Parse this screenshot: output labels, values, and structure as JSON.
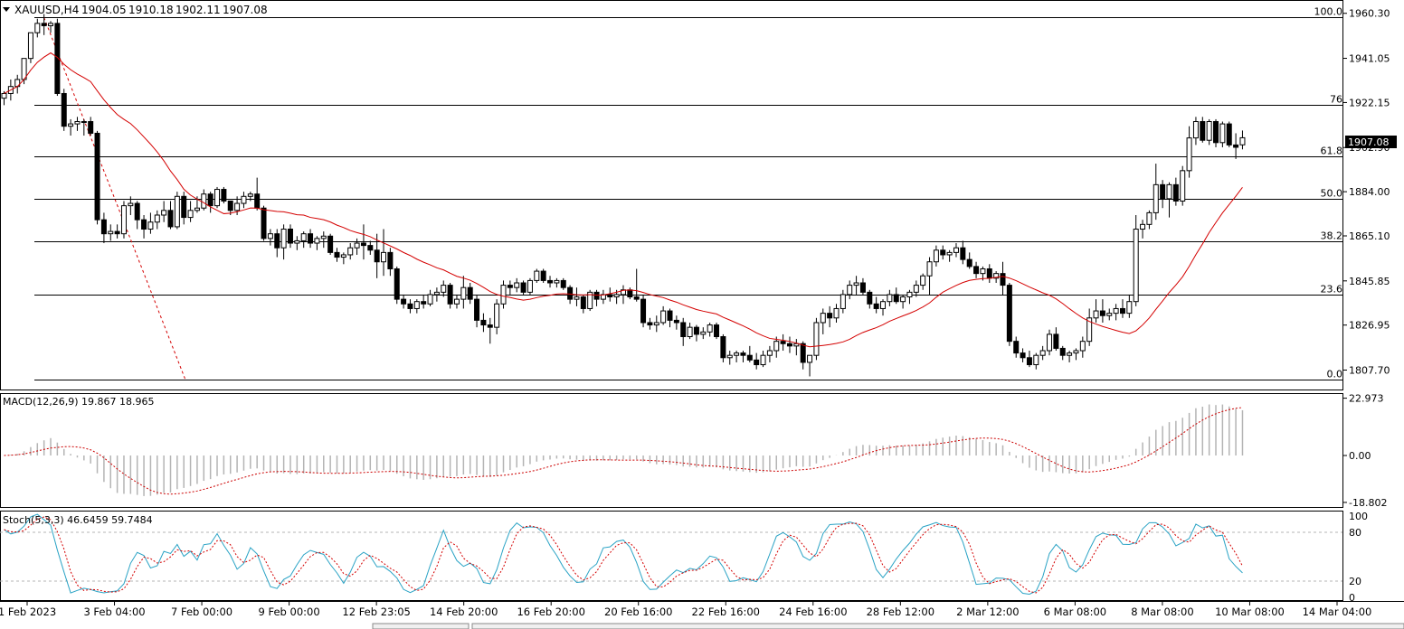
{
  "chart_data": {
    "type": "candlestick",
    "header": {
      "symbol": "XAUUSD,H4",
      "open": "1904.05",
      "high": "1910.18",
      "low": "1902.11",
      "close": "1907.08"
    },
    "current_price_label": "1907.08",
    "price_axis": {
      "ylim": [
        1799.0,
        1966.0
      ],
      "ticks": [
        "1960.30",
        "1941.05",
        "1922.15",
        "1902.90",
        "1884.00",
        "1865.10",
        "1845.85",
        "1826.95",
        "1807.70"
      ]
    },
    "fibonacci": {
      "swing_high": 1958.5,
      "swing_low": 1803.5,
      "levels": [
        {
          "label": "100.0",
          "ratio": 1.0
        },
        {
          "label": "76",
          "ratio": 0.76
        },
        {
          "label": "61.8",
          "ratio": 0.618
        },
        {
          "label": "50.0",
          "ratio": 0.5
        },
        {
          "label": "38.2",
          "ratio": 0.382
        },
        {
          "label": "23.6",
          "ratio": 0.236
        },
        {
          "label": "0.0",
          "ratio": 0.0
        }
      ]
    },
    "candles": [
      [
        1924.0,
        1927.0,
        1921.0,
        1926.0
      ],
      [
        1926.0,
        1932.0,
        1923.0,
        1929.0
      ],
      [
        1929.0,
        1934.0,
        1926.0,
        1932.0
      ],
      [
        1932.0,
        1940.0,
        1930.0,
        1941.0
      ],
      [
        1941.0,
        1950.0,
        1939.0,
        1952.0
      ],
      [
        1952.0,
        1958.0,
        1950.0,
        1956.0
      ],
      [
        1956.0,
        1960.0,
        1951.0,
        1955.0
      ],
      [
        1955.0,
        1957.0,
        1952.0,
        1956.0
      ],
      [
        1956.0,
        1958.0,
        1925.0,
        1926.0
      ],
      [
        1926.0,
        1928.0,
        1910.0,
        1912.0
      ],
      [
        1912.0,
        1915.0,
        1908.0,
        1913.0
      ],
      [
        1913.0,
        1916.0,
        1910.0,
        1914.0
      ],
      [
        1914.0,
        1915.0,
        1908.0,
        1914.0
      ],
      [
        1914.0,
        1916.0,
        1908.0,
        1909.0
      ],
      [
        1909.0,
        1910.0,
        1870.0,
        1872.0
      ],
      [
        1872.0,
        1875.0,
        1862.0,
        1866.0
      ],
      [
        1866.0,
        1870.0,
        1863.0,
        1867.0
      ],
      [
        1867.0,
        1870.0,
        1864.0,
        1866.0
      ],
      [
        1866.0,
        1880.0,
        1864.0,
        1878.0
      ],
      [
        1878.0,
        1882.0,
        1874.0,
        1879.0
      ],
      [
        1879.0,
        1880.0,
        1868.0,
        1872.0
      ],
      [
        1872.0,
        1874.0,
        1864.0,
        1868.0
      ],
      [
        1868.0,
        1875.0,
        1866.0,
        1871.0
      ],
      [
        1871.0,
        1876.0,
        1868.0,
        1874.0
      ],
      [
        1874.0,
        1880.0,
        1871.0,
        1876.0
      ],
      [
        1876.0,
        1880.0,
        1868.0,
        1869.0
      ],
      [
        1869.0,
        1884.0,
        1868.0,
        1882.0
      ],
      [
        1882.0,
        1884.0,
        1870.0,
        1873.0
      ],
      [
        1873.0,
        1880.0,
        1871.0,
        1876.0
      ],
      [
        1876.0,
        1882.0,
        1875.0,
        1877.0
      ],
      [
        1877.0,
        1885.0,
        1876.0,
        1883.0
      ],
      [
        1883.0,
        1884.0,
        1875.0,
        1878.0
      ],
      [
        1878.0,
        1886.0,
        1877.0,
        1885.0
      ],
      [
        1885.0,
        1886.0,
        1879.0,
        1880.0
      ],
      [
        1880.0,
        1880.0,
        1874.0,
        1876.0
      ],
      [
        1876.0,
        1882.0,
        1874.0,
        1879.0
      ],
      [
        1879.0,
        1884.0,
        1877.0,
        1882.0
      ],
      [
        1882.0,
        1884.0,
        1880.0,
        1883.0
      ],
      [
        1883.0,
        1890.0,
        1876.0,
        1877.0
      ],
      [
        1877.0,
        1878.0,
        1863.0,
        1864.0
      ],
      [
        1864.0,
        1868.0,
        1861.0,
        1866.0
      ],
      [
        1866.0,
        1868.0,
        1856.0,
        1860.0
      ],
      [
        1860.0,
        1870.0,
        1855.0,
        1868.0
      ],
      [
        1868.0,
        1870.0,
        1860.0,
        1862.0
      ],
      [
        1862.0,
        1865.0,
        1859.0,
        1863.0
      ],
      [
        1863.0,
        1867.0,
        1860.0,
        1866.0
      ],
      [
        1866.0,
        1868.0,
        1860.0,
        1862.0
      ],
      [
        1862.0,
        1865.0,
        1859.0,
        1864.0
      ],
      [
        1864.0,
        1867.0,
        1860.0,
        1865.0
      ],
      [
        1865.0,
        1866.0,
        1857.0,
        1858.0
      ],
      [
        1858.0,
        1860.0,
        1854.0,
        1856.0
      ],
      [
        1856.0,
        1858.0,
        1853.0,
        1857.0
      ],
      [
        1857.0,
        1862.0,
        1855.0,
        1860.0
      ],
      [
        1860.0,
        1864.0,
        1857.0,
        1862.0
      ],
      [
        1862.0,
        1870.0,
        1855.0,
        1861.0
      ],
      [
        1861.0,
        1863.0,
        1857.0,
        1859.0
      ],
      [
        1859.0,
        1866.0,
        1847.0,
        1854.0
      ],
      [
        1854.0,
        1868.0,
        1848.0,
        1858.0
      ],
      [
        1858.0,
        1860.0,
        1848.0,
        1851.0
      ],
      [
        1851.0,
        1852.0,
        1836.0,
        1838.0
      ],
      [
        1838.0,
        1840.0,
        1834.0,
        1836.0
      ],
      [
        1836.0,
        1838.0,
        1832.0,
        1834.0
      ],
      [
        1834.0,
        1838.0,
        1832.0,
        1837.0
      ],
      [
        1837.0,
        1840.0,
        1834.0,
        1836.0
      ],
      [
        1836.0,
        1842.0,
        1835.0,
        1840.0
      ],
      [
        1840.0,
        1843.0,
        1837.0,
        1841.0
      ],
      [
        1841.0,
        1846.0,
        1839.0,
        1844.0
      ],
      [
        1844.0,
        1845.0,
        1834.0,
        1836.0
      ],
      [
        1836.0,
        1840.0,
        1834.0,
        1838.0
      ],
      [
        1838.0,
        1848.0,
        1834.0,
        1843.0
      ],
      [
        1843.0,
        1845.0,
        1836.0,
        1838.0
      ],
      [
        1838.0,
        1840.0,
        1826.0,
        1829.0
      ],
      [
        1829.0,
        1832.0,
        1824.0,
        1827.0
      ],
      [
        1827.0,
        1830.0,
        1819.0,
        1826.0
      ],
      [
        1826.0,
        1838.0,
        1823.0,
        1836.0
      ],
      [
        1836.0,
        1846.0,
        1834.0,
        1844.0
      ],
      [
        1844.0,
        1846.0,
        1840.0,
        1843.0
      ],
      [
        1843.0,
        1847.0,
        1841.0,
        1845.0
      ],
      [
        1845.0,
        1846.0,
        1840.0,
        1841.0
      ],
      [
        1841.0,
        1847.0,
        1840.0,
        1846.0
      ],
      [
        1846.0,
        1851.0,
        1845.0,
        1850.0
      ],
      [
        1850.0,
        1851.0,
        1845.0,
        1846.0
      ],
      [
        1846.0,
        1848.0,
        1843.0,
        1845.0
      ],
      [
        1845.0,
        1847.0,
        1843.0,
        1846.0
      ],
      [
        1846.0,
        1847.0,
        1842.0,
        1843.0
      ],
      [
        1843.0,
        1844.0,
        1836.0,
        1838.0
      ],
      [
        1838.0,
        1843.0,
        1835.0,
        1839.0
      ],
      [
        1839.0,
        1840.0,
        1832.0,
        1834.0
      ],
      [
        1834.0,
        1842.0,
        1833.0,
        1841.0
      ],
      [
        1841.0,
        1842.0,
        1835.0,
        1838.0
      ],
      [
        1838.0,
        1842.0,
        1836.0,
        1840.0
      ],
      [
        1840.0,
        1843.0,
        1837.0,
        1839.0
      ],
      [
        1839.0,
        1842.0,
        1836.0,
        1840.0
      ],
      [
        1840.0,
        1844.0,
        1836.0,
        1842.0
      ],
      [
        1842.0,
        1843.0,
        1838.0,
        1839.0
      ],
      [
        1839.0,
        1851.0,
        1837.0,
        1838.0
      ],
      [
        1838.0,
        1840.0,
        1826.0,
        1828.0
      ],
      [
        1828.0,
        1830.0,
        1825.0,
        1827.0
      ],
      [
        1827.0,
        1831.0,
        1824.0,
        1828.0
      ],
      [
        1828.0,
        1835.0,
        1827.0,
        1833.0
      ],
      [
        1833.0,
        1834.0,
        1826.0,
        1829.0
      ],
      [
        1829.0,
        1831.0,
        1825.0,
        1828.0
      ],
      [
        1828.0,
        1830.0,
        1818.0,
        1822.0
      ],
      [
        1822.0,
        1828.0,
        1821.0,
        1826.0
      ],
      [
        1826.0,
        1827.0,
        1820.0,
        1823.0
      ],
      [
        1823.0,
        1826.0,
        1821.0,
        1824.0
      ],
      [
        1824.0,
        1828.0,
        1822.0,
        1827.0
      ],
      [
        1827.0,
        1828.0,
        1821.0,
        1822.0
      ],
      [
        1822.0,
        1823.0,
        1811.0,
        1813.0
      ],
      [
        1813.0,
        1816.0,
        1810.0,
        1814.0
      ],
      [
        1814.0,
        1816.0,
        1811.0,
        1815.0
      ],
      [
        1815.0,
        1816.0,
        1811.0,
        1814.0
      ],
      [
        1814.0,
        1818.0,
        1811.0,
        1812.0
      ],
      [
        1812.0,
        1815.0,
        1808.0,
        1810.0
      ],
      [
        1810.0,
        1816.0,
        1809.0,
        1814.0
      ],
      [
        1814.0,
        1818.0,
        1811.0,
        1816.0
      ],
      [
        1816.0,
        1822.0,
        1813.0,
        1820.0
      ],
      [
        1820.0,
        1823.0,
        1816.0,
        1819.0
      ],
      [
        1819.0,
        1822.0,
        1815.0,
        1818.0
      ],
      [
        1818.0,
        1821.0,
        1814.0,
        1819.0
      ],
      [
        1819.0,
        1820.0,
        1808.0,
        1811.0
      ],
      [
        1811.0,
        1813.0,
        1805.0,
        1814.0
      ],
      [
        1814.0,
        1830.0,
        1812.0,
        1828.0
      ],
      [
        1828.0,
        1834.0,
        1823.0,
        1832.0
      ],
      [
        1832.0,
        1835.0,
        1826.0,
        1830.0
      ],
      [
        1830.0,
        1836.0,
        1828.0,
        1834.0
      ],
      [
        1834.0,
        1842.0,
        1832.0,
        1840.0
      ],
      [
        1840.0,
        1846.0,
        1838.0,
        1844.0
      ],
      [
        1844.0,
        1848.0,
        1840.0,
        1845.0
      ],
      [
        1845.0,
        1847.0,
        1840.0,
        1841.0
      ],
      [
        1841.0,
        1842.0,
        1834.0,
        1836.0
      ],
      [
        1836.0,
        1839.0,
        1832.0,
        1834.0
      ],
      [
        1834.0,
        1838.0,
        1831.0,
        1837.0
      ],
      [
        1837.0,
        1842.0,
        1835.0,
        1840.0
      ],
      [
        1840.0,
        1843.0,
        1836.0,
        1837.0
      ],
      [
        1837.0,
        1840.0,
        1834.0,
        1839.0
      ],
      [
        1839.0,
        1842.0,
        1836.0,
        1841.0
      ],
      [
        1841.0,
        1846.0,
        1839.0,
        1844.0
      ],
      [
        1844.0,
        1849.0,
        1842.0,
        1848.0
      ],
      [
        1848.0,
        1856.0,
        1840.0,
        1854.0
      ],
      [
        1854.0,
        1861.0,
        1852.0,
        1859.0
      ],
      [
        1859.0,
        1861.0,
        1855.0,
        1857.0
      ],
      [
        1857.0,
        1859.0,
        1854.0,
        1858.0
      ],
      [
        1858.0,
        1862.0,
        1856.0,
        1860.0
      ],
      [
        1860.0,
        1863.0,
        1853.0,
        1855.0
      ],
      [
        1855.0,
        1858.0,
        1851.0,
        1852.0
      ],
      [
        1852.0,
        1854.0,
        1847.0,
        1849.0
      ],
      [
        1849.0,
        1852.0,
        1846.0,
        1851.0
      ],
      [
        1851.0,
        1853.0,
        1845.0,
        1847.0
      ],
      [
        1847.0,
        1850.0,
        1845.0,
        1849.0
      ],
      [
        1849.0,
        1854.0,
        1840.0,
        1844.0
      ],
      [
        1844.0,
        1845.0,
        1818.0,
        1820.0
      ],
      [
        1820.0,
        1822.0,
        1813.0,
        1815.0
      ],
      [
        1815.0,
        1817.0,
        1811.0,
        1813.0
      ],
      [
        1813.0,
        1816.0,
        1809.0,
        1810.0
      ],
      [
        1810.0,
        1815.0,
        1808.0,
        1814.0
      ],
      [
        1814.0,
        1818.0,
        1812.0,
        1816.0
      ],
      [
        1816.0,
        1825.0,
        1814.0,
        1823.0
      ],
      [
        1823.0,
        1826.0,
        1816.0,
        1817.0
      ],
      [
        1817.0,
        1818.0,
        1812.0,
        1814.0
      ],
      [
        1814.0,
        1816.0,
        1811.0,
        1815.0
      ],
      [
        1815.0,
        1817.0,
        1812.0,
        1816.0
      ],
      [
        1816.0,
        1822.0,
        1813.0,
        1820.0
      ],
      [
        1820.0,
        1834.0,
        1818.0,
        1830.0
      ],
      [
        1830.0,
        1838.0,
        1828.0,
        1833.0
      ],
      [
        1833.0,
        1838.0,
        1828.0,
        1831.0
      ],
      [
        1831.0,
        1834.0,
        1829.0,
        1832.0
      ],
      [
        1832.0,
        1836.0,
        1829.0,
        1834.0
      ],
      [
        1834.0,
        1838.0,
        1830.0,
        1832.0
      ],
      [
        1832.0,
        1840.0,
        1830.0,
        1837.0
      ],
      [
        1837.0,
        1874.0,
        1835.0,
        1868.0
      ],
      [
        1868.0,
        1872.0,
        1864.0,
        1870.0
      ],
      [
        1870.0,
        1876.0,
        1868.0,
        1875.0
      ],
      [
        1875.0,
        1896.0,
        1872.0,
        1887.0
      ],
      [
        1887.0,
        1889.0,
        1877.0,
        1881.0
      ],
      [
        1881.0,
        1888.0,
        1873.0,
        1887.0
      ],
      [
        1887.0,
        1890.0,
        1878.0,
        1880.0
      ],
      [
        1880.0,
        1895.0,
        1878.0,
        1893.0
      ],
      [
        1893.0,
        1912.0,
        1890.0,
        1907.0
      ],
      [
        1907.0,
        1916.0,
        1904.0,
        1914.0
      ],
      [
        1914.0,
        1916.0,
        1905.0,
        1906.0
      ],
      [
        1906.0,
        1915.0,
        1904.0,
        1914.0
      ],
      [
        1914.0,
        1915.0,
        1903.0,
        1905.0
      ],
      [
        1905.0,
        1914.0,
        1903.0,
        1913.0
      ],
      [
        1913.0,
        1914.0,
        1903.0,
        1904.0
      ],
      [
        1904.0,
        1909.0,
        1898.0,
        1903.0
      ],
      [
        1904.05,
        1910.18,
        1902.11,
        1907.08
      ]
    ],
    "ma_period": 20,
    "macd": {
      "label": "MACD(12,26,9) 19.867 18.965",
      "ylim": [
        -21.0,
        25.0
      ],
      "ticks": [
        "22.973",
        "0.00",
        "-18.802"
      ]
    },
    "stoch": {
      "label": "Stoch(5,3,3) 46.6459 59.7484",
      "ylim": [
        0,
        100
      ],
      "ticks": [
        "100",
        "80",
        "20",
        "0"
      ],
      "levels": [
        80,
        20
      ]
    },
    "x_labels": [
      "1 Feb 2023",
      "3 Feb 04:00",
      "7 Feb 00:00",
      "9 Feb 00:00",
      "12 Feb 23:05",
      "14 Feb 20:00",
      "16 Feb 20:00",
      "20 Feb 16:00",
      "22 Feb 16:00",
      "24 Feb 16:00",
      "28 Feb 12:00",
      "2 Mar 12:00",
      "6 Mar 08:00",
      "8 Mar 08:00",
      "10 Mar 08:00",
      "14 Mar 04:00"
    ],
    "colors": {
      "up_body": "#ffffff",
      "down_body": "#000000",
      "candle_outline": "#000000",
      "moving_average": "#d40000",
      "signal_line": "#cc0000",
      "macd_histogram": "#b4b4b4",
      "stoch_main": "#2aa3c5",
      "stoch_signal": "#d40000",
      "fib_trend": "#d40000",
      "level_line": "#000000",
      "price_tag_bg": "#000000",
      "price_tag_text": "#ffffff"
    }
  }
}
